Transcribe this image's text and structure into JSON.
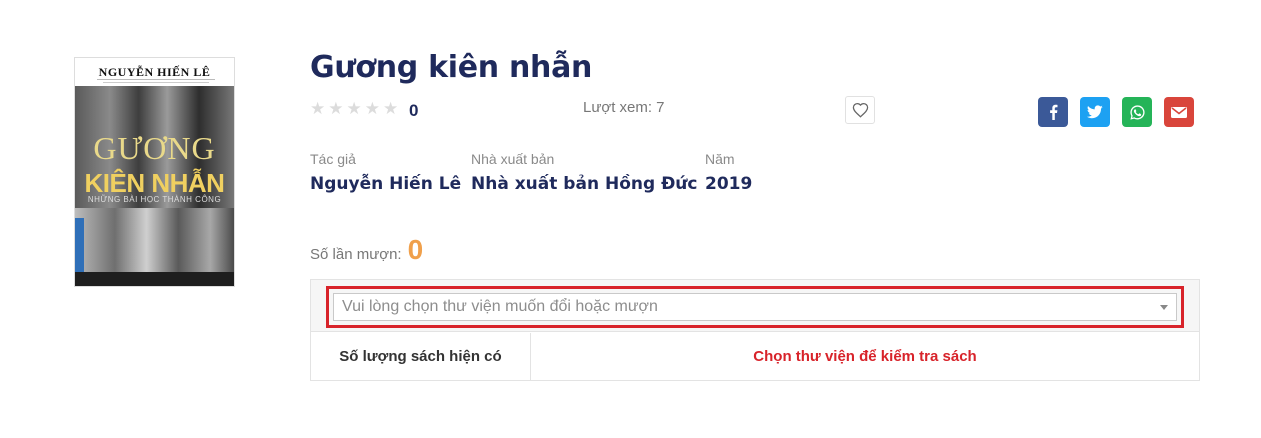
{
  "cover": {
    "author": "NGUYỄN HIẾN LÊ",
    "title_line1": "GƯƠNG",
    "title_line2": "KIÊN NHẪN",
    "subtitle": "NHỮNG BÀI HỌC THÀNH CÔNG"
  },
  "book": {
    "title": "Gương kiên nhẫn",
    "rating_count": "0",
    "views_label": "Lượt xem:",
    "views_value": "7"
  },
  "meta": {
    "author_label": "Tác giả",
    "author_value": "Nguyễn Hiến Lê",
    "publisher_label": "Nhà xuất bản",
    "publisher_value": "Nhà xuất bản Hồng Đức",
    "year_label": "Năm",
    "year_value": "2019"
  },
  "borrow": {
    "label": "Số lần mượn:",
    "count": "0"
  },
  "library": {
    "select_placeholder": "Vui lòng chọn thư viện muốn đổi hoặc mượn",
    "stock_label": "Số lượng sách hiện có",
    "stock_message": "Chọn thư viện để kiểm tra sách"
  },
  "share": {
    "icons": [
      "facebook-icon",
      "twitter-icon",
      "whatsapp-icon",
      "email-icon"
    ]
  },
  "colors": {
    "title": "#1f2a5c",
    "borrow_count": "#f0a04b",
    "highlight": "#d8232a",
    "facebook": "#3b5998",
    "twitter": "#1da1f2",
    "whatsapp": "#25b458",
    "email": "#d9453b"
  }
}
